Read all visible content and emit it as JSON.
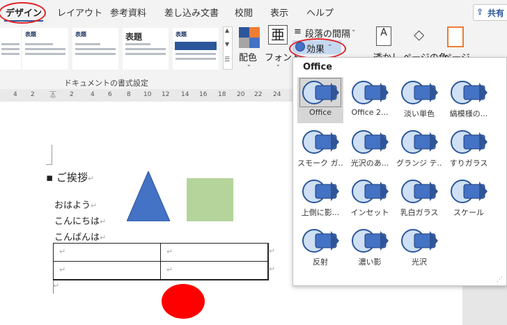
{
  "tabs": {
    "items": [
      "デザイン",
      "レイアウト",
      "参考資料",
      "差し込み文書",
      "校閲",
      "表示",
      "ヘルプ"
    ],
    "share": "共有"
  },
  "ribbon": {
    "style_thumbs": [
      {
        "title": "表題"
      },
      {
        "title": "表題"
      },
      {
        "title": "表題"
      },
      {
        "title": "表題"
      },
      {
        "title": "表題"
      }
    ],
    "colors_label": "配色",
    "fonts_label": "フォント",
    "fonts_icon_char": "亜",
    "paragraph_spacing": "段落の間隔",
    "effects_button": "効果",
    "watermark": "透かし",
    "page_color": "ページの色",
    "page_border": "ページ",
    "group_label": "ドキュメントの書式設定"
  },
  "ruler": {
    "numbers": [
      "4",
      "2",
      "2",
      "4",
      "6",
      "8",
      "10",
      "12",
      "14",
      "16",
      "18",
      "20",
      "22",
      "24"
    ]
  },
  "document": {
    "heading": "ご挨拶",
    "lines": [
      "おはよう",
      "こんにちは",
      "こんばんは"
    ],
    "shape_colors": {
      "triangle": "#4472c4",
      "rectangle": "#b4d49c",
      "circle": "#ff0000"
    }
  },
  "effects_dropdown": {
    "title": "Office",
    "items": [
      {
        "label": "Office",
        "selected": true
      },
      {
        "label": "Office 2...",
        "selected": false
      },
      {
        "label": "淡い単色",
        "selected": false
      },
      {
        "label": "縞模様の...",
        "selected": false
      },
      {
        "label": "スモーク ガ...",
        "selected": false
      },
      {
        "label": "光沢のあ...",
        "selected": false
      },
      {
        "label": "グランジ テ...",
        "selected": false
      },
      {
        "label": "すりガラス",
        "selected": false
      },
      {
        "label": "上側に影...",
        "selected": false
      },
      {
        "label": "インセット",
        "selected": false
      },
      {
        "label": "乳白ガラス",
        "selected": false
      },
      {
        "label": "スケール",
        "selected": false
      },
      {
        "label": "反射",
        "selected": false
      },
      {
        "label": "濃い影",
        "selected": false
      },
      {
        "label": "光沢",
        "selected": false
      }
    ]
  },
  "colors": {
    "accent": "#2b579a",
    "highlight_ring": "#e0242a"
  }
}
